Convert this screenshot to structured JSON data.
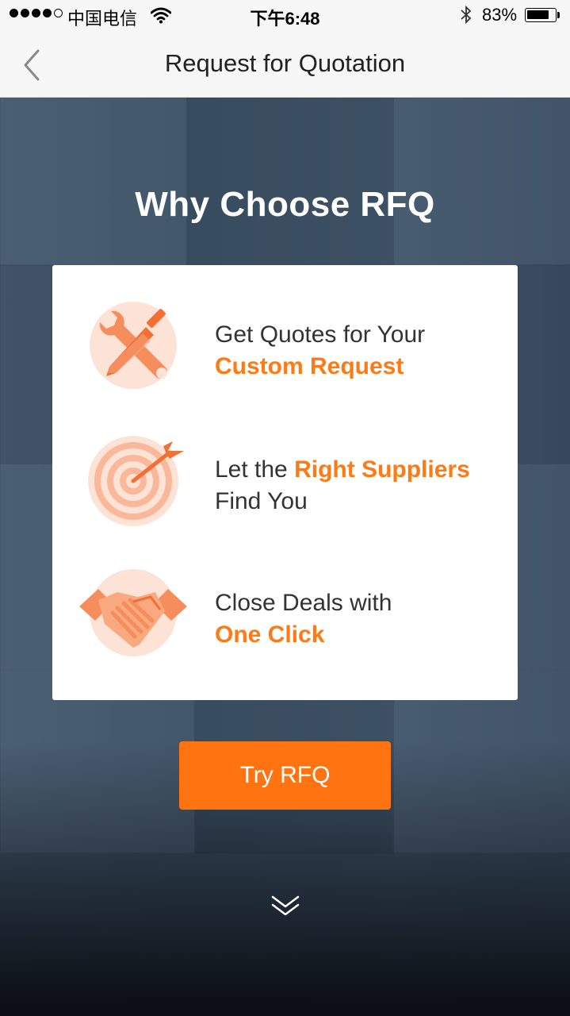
{
  "status_bar": {
    "carrier": "中国电信",
    "time": "下午6:48",
    "battery_percent": "83%",
    "battery_level": 0.83,
    "signal_bars_filled": 4,
    "signal_bars_total": 5
  },
  "nav": {
    "title": "Request for Quotation",
    "back_icon": "chevron-left-icon"
  },
  "hero": {
    "headline": "Why Choose RFQ"
  },
  "features": [
    {
      "icon": "tools-icon",
      "line1": "Get Quotes for Your",
      "highlight": "Custom Request",
      "line2": ""
    },
    {
      "icon": "target-icon",
      "line1": "Let the ",
      "highlight": "Right Suppliers",
      "line2": "Find You"
    },
    {
      "icon": "handshake-icon",
      "line1": "Close Deals with",
      "highlight": "One Click",
      "line2": ""
    }
  ],
  "cta": {
    "label": "Try RFQ"
  },
  "scroll_hint_icon": "double-chevron-down-icon",
  "colors": {
    "accent": "#ff7a14",
    "button": "#ff7411",
    "icon_bg": "#fde3d6"
  }
}
